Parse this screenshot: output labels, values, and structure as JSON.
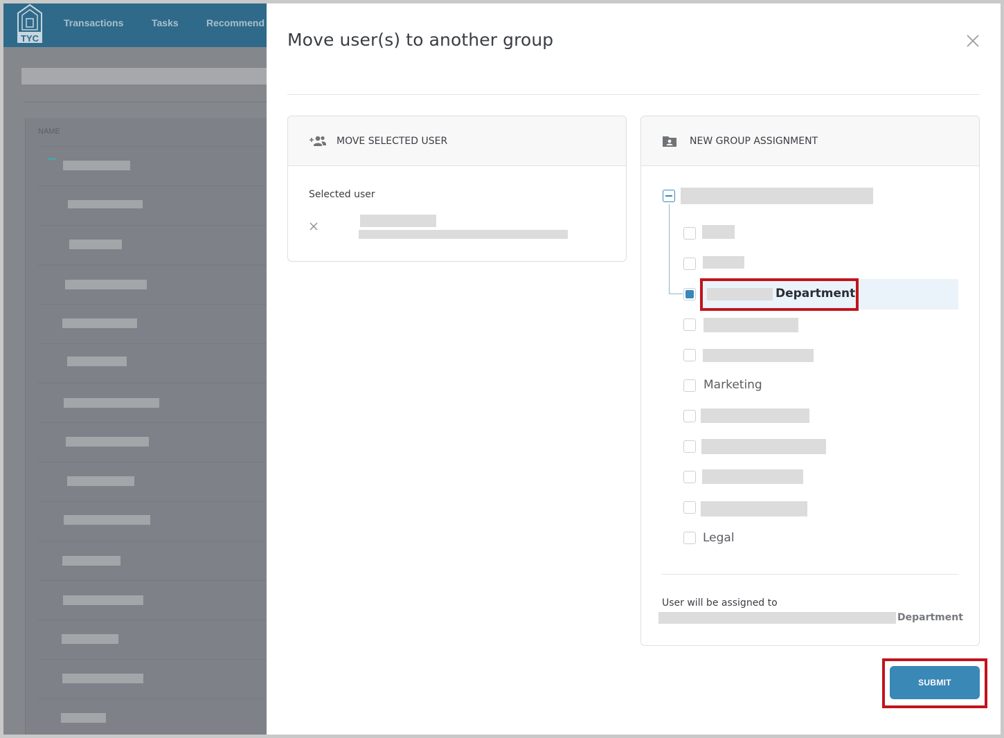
{
  "app": {
    "logo_text": "TYC",
    "nav": [
      "Transactions",
      "Tasks",
      "Recommend"
    ],
    "table_header": "NAME"
  },
  "modal": {
    "title": "Move user(s) to another group",
    "close_icon": "close-icon"
  },
  "left_panel": {
    "header": "MOVE SELECTED USER",
    "header_icon": "add-group-icon",
    "selected_user_label": "Selected user"
  },
  "right_panel": {
    "header": "NEW GROUP ASSIGNMENT",
    "header_icon": "folder-user-icon",
    "tree": {
      "highlighted_label": "Department",
      "items": [
        "Marketing",
        "Legal"
      ]
    },
    "assignment_label": "User will be assigned to",
    "assignment_value": "Department"
  },
  "actions": {
    "submit_label": "SUBMIT"
  },
  "colors": {
    "accent": "#3a88b6",
    "annotation": "#c0141c"
  }
}
